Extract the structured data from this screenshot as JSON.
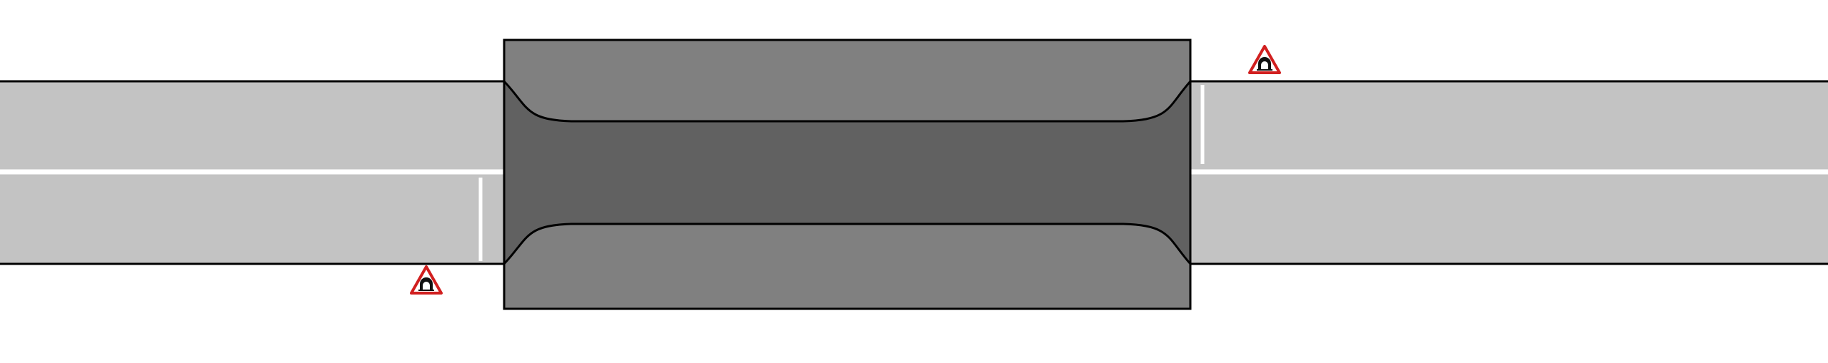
{
  "diagram": {
    "type": "road-tunnel-schematic",
    "colors": {
      "background": "#ffffff",
      "road_surface": "#c3c3c3",
      "road_outline": "#000000",
      "lane_marking": "#ffffff",
      "tunnel_block": "#808080",
      "tunnel_bore": "#616161",
      "sign_border": "#d11f1f",
      "sign_fill": "#ffffff",
      "sign_symbol": "#111111"
    },
    "elements": {
      "roads": [
        "road-west",
        "road-east"
      ],
      "tunnel": "tunnel-block",
      "signs": [
        {
          "id": "sign-west",
          "icon": "tunnel-warning-icon"
        },
        {
          "id": "sign-east",
          "icon": "tunnel-warning-icon"
        }
      ],
      "stop_lines": [
        "stop-line-west",
        "stop-line-east"
      ]
    }
  }
}
